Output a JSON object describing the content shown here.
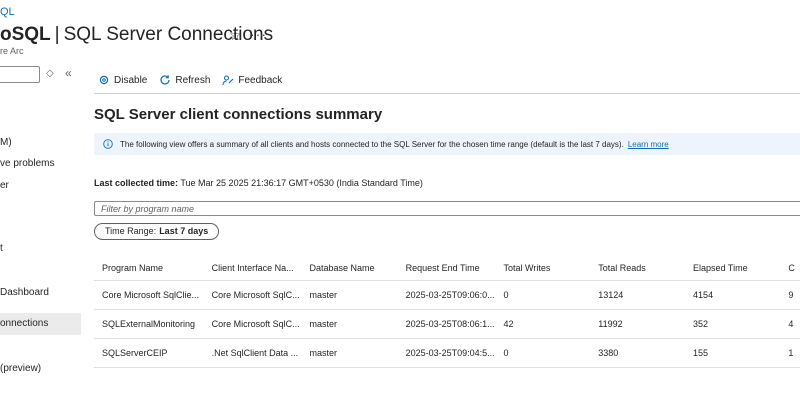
{
  "header": {
    "breadcrumb": "QL",
    "title_bold": "oSQL",
    "title_sep": "|",
    "title_rest": "SQL Server Connections",
    "subtitle": "re Arc",
    "star_icon": "star-icon",
    "more_icon": "more-icon"
  },
  "nav": {
    "items": [
      {
        "label": "M)"
      },
      {
        "label": "ve problems"
      },
      {
        "label": "er"
      },
      {
        "label": "t"
      },
      {
        "label": "Dashboard"
      },
      {
        "label": "onnections",
        "active": true
      },
      {
        "label": "(preview)"
      }
    ]
  },
  "toolbar": {
    "disable": "Disable",
    "refresh": "Refresh",
    "feedback": "Feedback"
  },
  "main": {
    "heading": "SQL Server client connections summary",
    "info_text": "The following view offers a summary of all clients and hosts connected to the SQL Server for the chosen time range (default is the last 7 days).",
    "info_link": "Learn more",
    "last_collected_label": "Last collected time:",
    "last_collected_value": "Tue Mar 25 2025 21:36:17 GMT+0530 (India Standard Time)",
    "filter_placeholder": "Filter by program name",
    "time_range_label": "Time Range:",
    "time_range_value": "Last 7 days"
  },
  "table": {
    "columns": [
      "Program Name",
      "Client Interface Na...",
      "Database Name",
      "Request End Time",
      "Total Writes",
      "Total Reads",
      "Elapsed Time",
      "C"
    ],
    "rows": [
      [
        "Core Microsoft SqlClie...",
        "Core Microsoft SqlC...",
        "master",
        "2025-03-25T09:06:0...",
        "0",
        "13124",
        "4154",
        "9"
      ],
      [
        "SQLExternalMonitoring",
        "Core Microsoft SqlC...",
        "master",
        "2025-03-25T08:06:1...",
        "42",
        "11992",
        "352",
        "4"
      ],
      [
        "SQLServerCEIP",
        ".Net SqlClient Data ...",
        "master",
        "2025-03-25T09:04:5...",
        "0",
        "3380",
        "155",
        "1"
      ]
    ]
  },
  "colors": {
    "accent": "#0f6cbd",
    "info_bg": "#eef4fb"
  }
}
